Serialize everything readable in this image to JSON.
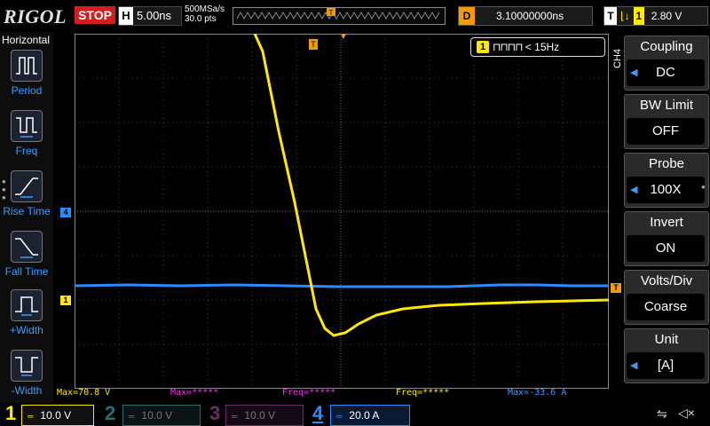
{
  "header": {
    "brand": "RIGOL",
    "run_state": "STOP",
    "timebase_letter": "H",
    "timebase": "5.00ns",
    "sample_rate": "500MSa/s",
    "memory_depth": "30.0 pts",
    "delay_letter": "D",
    "delay": "3.10000000ns",
    "trigger_letter": "T",
    "trigger_source": "1",
    "trigger_level": "2.80 V"
  },
  "left_menu": {
    "title": "Horizontal",
    "items": [
      {
        "label": "Period",
        "icon": "period-icon"
      },
      {
        "label": "Freq",
        "icon": "freq-icon"
      },
      {
        "label": "Rise Time",
        "icon": "rise-time-icon"
      },
      {
        "label": "Fall Time",
        "icon": "fall-time-icon"
      },
      {
        "label": "+Width",
        "icon": "pos-width-icon"
      },
      {
        "label": "-Width",
        "icon": "neg-width-icon"
      }
    ]
  },
  "freq_counter": {
    "channel": "1",
    "text": "< 15Hz"
  },
  "channel_tag": "CH4",
  "right_menu": {
    "items": [
      {
        "title": "Coupling",
        "value": "DC",
        "arrow": true
      },
      {
        "title": "BW Limit",
        "value": "OFF",
        "arrow": false
      },
      {
        "title": "Probe",
        "value": "100X",
        "arrow": true
      },
      {
        "title": "Invert",
        "value": "ON",
        "arrow": false
      },
      {
        "title": "Volts/Div",
        "value": "Coarse",
        "arrow": false
      },
      {
        "title": "Unit",
        "value": "[A]",
        "arrow": true
      }
    ]
  },
  "markers": {
    "ch4": "4",
    "ch1": "1",
    "trigger": "T"
  },
  "measurements": [
    {
      "text": "Max=70.8 V",
      "color": "#ffe900"
    },
    {
      "text": "Max=*****",
      "color": "#ff2bff"
    },
    {
      "text": "Freq=*****",
      "color": "#ff2bff"
    },
    {
      "text": "Freq=*****",
      "color": "#ffe900"
    },
    {
      "text": "Max=-33.6 A",
      "color": "#3b9cff"
    }
  ],
  "channels": [
    {
      "num": "1",
      "scale": "10.0 V",
      "color": "#ffe900",
      "active": true
    },
    {
      "num": "2",
      "scale": "10.0 V",
      "color": "#2a6f6f",
      "active": false
    },
    {
      "num": "3",
      "scale": "10.0 V",
      "color": "#6e2a6e",
      "active": false
    },
    {
      "num": "4",
      "scale": "20.0 A",
      "color": "#2b8cff",
      "active": true
    }
  ],
  "colors": {
    "ch1": "#ffe900",
    "ch4": "#2b8cff",
    "trigger": "#f39b00",
    "menu_accent": "#3b9cff"
  }
}
